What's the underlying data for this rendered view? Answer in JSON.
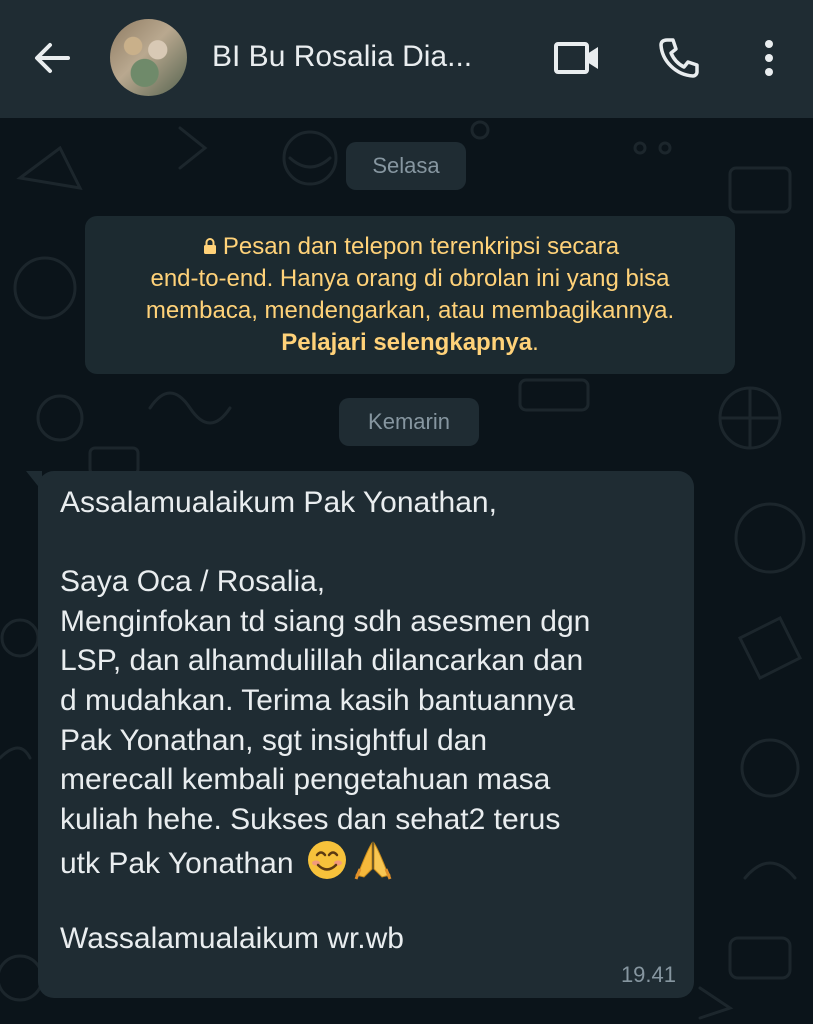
{
  "header": {
    "title": "BI Bu Rosalia Dia...",
    "icons": [
      "back-arrow-icon",
      "avatar",
      "video-call-icon",
      "phone-call-icon",
      "more-options-icon"
    ]
  },
  "chat": {
    "date_chip_1": "Selasa",
    "encryption_notice": {
      "text_line_1": "Pesan dan telepon terenkripsi secara",
      "text_line_2": "end-to-end. Hanya orang di obrolan ini yang bisa",
      "text_line_3": "membaca, mendengarkan, atau membagikannya.",
      "link": "Pelajari selengkapnya",
      "link_suffix": ".",
      "icon": "lock-icon"
    },
    "date_chip_2": "Kemarin",
    "message": {
      "lines": [
        "Assalamualaikum Pak Yonathan,",
        "",
        "Saya Oca / Rosalia,",
        "Menginfokan td siang sdh asesmen dgn",
        "LSP, dan alhamdulillah dilancarkan dan",
        "d mudahkan. Terima kasih bantuannya",
        "Pak Yonathan, sgt insightful dan",
        "merecall kembali pengetahuan masa",
        "kuliah hehe. Sukses dan sehat2 terus",
        "utk Pak Yonathan",
        "",
        "Wassalamualaikum wr.wb"
      ],
      "emojis": [
        "smiling-face-emoji",
        "folded-hands-emoji"
      ],
      "time": "19.41"
    }
  },
  "colors": {
    "header_bg": "#1f2c33",
    "chat_bg": "#0b141a",
    "bubble_bg": "#1f2c33",
    "notice_text": "#ffd279",
    "secondary_text": "#8696a0"
  }
}
